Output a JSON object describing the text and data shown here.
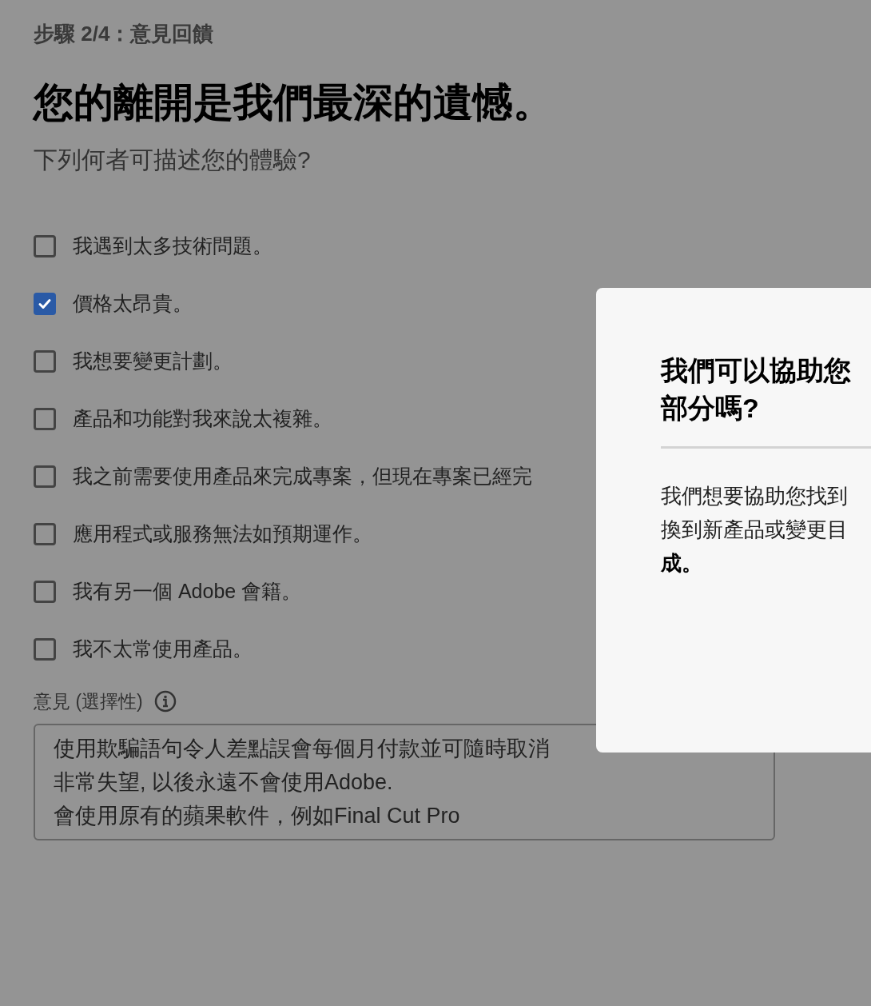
{
  "step_label": "步驟 2/4：意見回饋",
  "heading": "您的離開是我們最深的遺憾。",
  "question": "下列何者可描述您的體驗?",
  "options": [
    {
      "label": "我遇到太多技術問題。",
      "checked": false
    },
    {
      "label": "價格太昂貴。",
      "checked": true
    },
    {
      "label": "我想要變更計劃。",
      "checked": false
    },
    {
      "label": "產品和功能對我來說太複雜。",
      "checked": false
    },
    {
      "label": "我之前需要使用產品來完成專案，但現在專案已經完",
      "checked": false
    },
    {
      "label": "應用程式或服務無法如預期運作。",
      "checked": false
    },
    {
      "label": "我有另一個 Adobe 會籍。",
      "checked": false
    },
    {
      "label": "我不太常使用產品。",
      "checked": false
    }
  ],
  "comment": {
    "label": "意見 (選擇性)",
    "lines": [
      "使用欺騙語句令人差點誤會每個月付款並可隨時取消",
      "非常失望, 以後永遠不會使用Adobe.",
      "會使用原有的蘋果軟件，例如Final Cut Pro"
    ]
  },
  "dialog": {
    "title_lines": [
      "我們可以協助您",
      "部分嗎?"
    ],
    "body_lines": [
      {
        "text": "我們想要協助您找到",
        "bold": false
      },
      {
        "text": "換到新產品或變更目",
        "bold": false
      },
      {
        "text": "成。",
        "bold": true
      }
    ]
  }
}
